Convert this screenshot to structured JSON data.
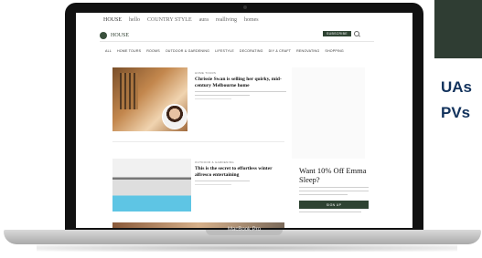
{
  "laptop": {
    "model_label": "MacBook Pro"
  },
  "site": {
    "brands": [
      "HOUSE",
      "hello",
      "COUNTRY STYLE",
      "aura",
      "realliving",
      "homes"
    ],
    "logo_text": "HOUSE",
    "subscribe_label": "SUBSCRIBE",
    "nav": [
      "ALL",
      "HOME TOURS",
      "ROOMS",
      "OUTDOOR & GARDENING",
      "LIFESTYLE",
      "DECORATING",
      "DIY & CRAFT",
      "RENOVATING",
      "SHOPPING"
    ]
  },
  "articles": [
    {
      "category": "HOME TOURS",
      "headline": "Chrissie Swan is selling her quirky, mid-century Melbourne home"
    },
    {
      "category": "OUTDOOR & GARDENING",
      "headline": "This is the secret to effortless winter alfresco entertaining"
    }
  ],
  "promo": {
    "title": "Want 10% Off Emma Sleep?",
    "signup_label": "SIGN UP"
  },
  "side_text": [
    "UAs",
    "PVs"
  ],
  "colors": {
    "brand_green": "#2e4332",
    "side_text": "#12325c"
  }
}
